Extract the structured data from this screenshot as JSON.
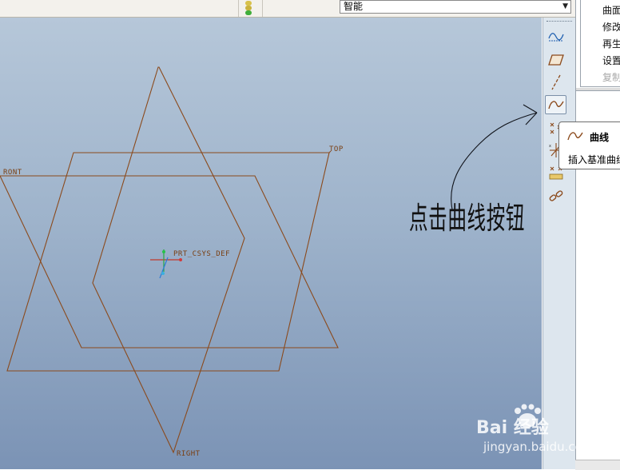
{
  "toolbar": {
    "filter_value": "智能"
  },
  "viewport": {
    "datum_planes": {
      "front": "RONT",
      "top": "TOP",
      "right": "RIGHT"
    },
    "csys_label": "PRT_CSYS_DEF",
    "annotation": "点击曲线按钮"
  },
  "datum_toolbar": {
    "tools": [
      {
        "name": "sketch-curve",
        "active": false
      },
      {
        "name": "datum-plane",
        "active": false
      },
      {
        "name": "datum-axis",
        "active": false
      },
      {
        "name": "datum-curve",
        "active": true
      },
      {
        "name": "datum-point",
        "active": false
      },
      {
        "name": "coordinate-system",
        "active": false
      },
      {
        "name": "analysis",
        "active": false
      },
      {
        "name": "chain",
        "active": false
      }
    ]
  },
  "tooltip": {
    "title": "曲线",
    "description": "插入基准曲线"
  },
  "menu": {
    "items": [
      {
        "label": "曲面",
        "disabled": false
      },
      {
        "label": "修改",
        "disabled": false
      },
      {
        "label": "再生",
        "disabled": false
      },
      {
        "label": "设置",
        "disabled": false
      },
      {
        "label": "复制",
        "disabled": true
      }
    ]
  },
  "watermark": {
    "brand": "Bai 经验",
    "url": "jingyan.baidu.com"
  },
  "colors": {
    "datum_line": "#8b4a1c",
    "toolbar_bg": "#dde6ee"
  }
}
